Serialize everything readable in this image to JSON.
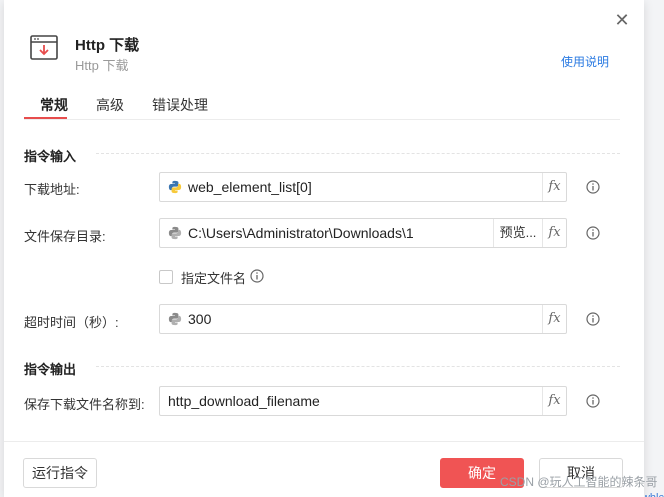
{
  "dialog": {
    "title": "Http 下载",
    "subtitle": "Http 下载",
    "help_link": "使用说明",
    "close_icon": "close-icon",
    "header_icon": "download-window-icon"
  },
  "tabs": [
    {
      "label": "常规",
      "active": true
    },
    {
      "label": "高级",
      "active": false
    },
    {
      "label": "错误处理",
      "active": false
    }
  ],
  "input_section": {
    "title": "指令输入",
    "download_url": {
      "label": "下载地址:",
      "value": "web_element_list[0]",
      "icon": "python-icon"
    },
    "save_dir": {
      "label": "文件保存目录:",
      "value": "C:\\Users\\Administrator\\Downloads\\1",
      "browse_label": "预览...",
      "icon": "python-icon"
    },
    "specify_filename": {
      "label": "指定文件名",
      "checked": false
    },
    "timeout": {
      "label": "超时时间（秒）:",
      "value": "300",
      "icon": "python-icon"
    }
  },
  "output_section": {
    "title": "指令输出",
    "save_name": {
      "label": "保存下载文件名称到:",
      "value": "http_download_filename"
    }
  },
  "fx_label": "fx",
  "footer": {
    "run_label": "运行指令",
    "ok_label": "确定",
    "cancel_label": "取消"
  },
  "watermark": "CSDN @玩人工智能的辣条哥",
  "background_fragment": "whlc",
  "colors": {
    "accent": "#f05454",
    "link": "#2a7ae2"
  }
}
